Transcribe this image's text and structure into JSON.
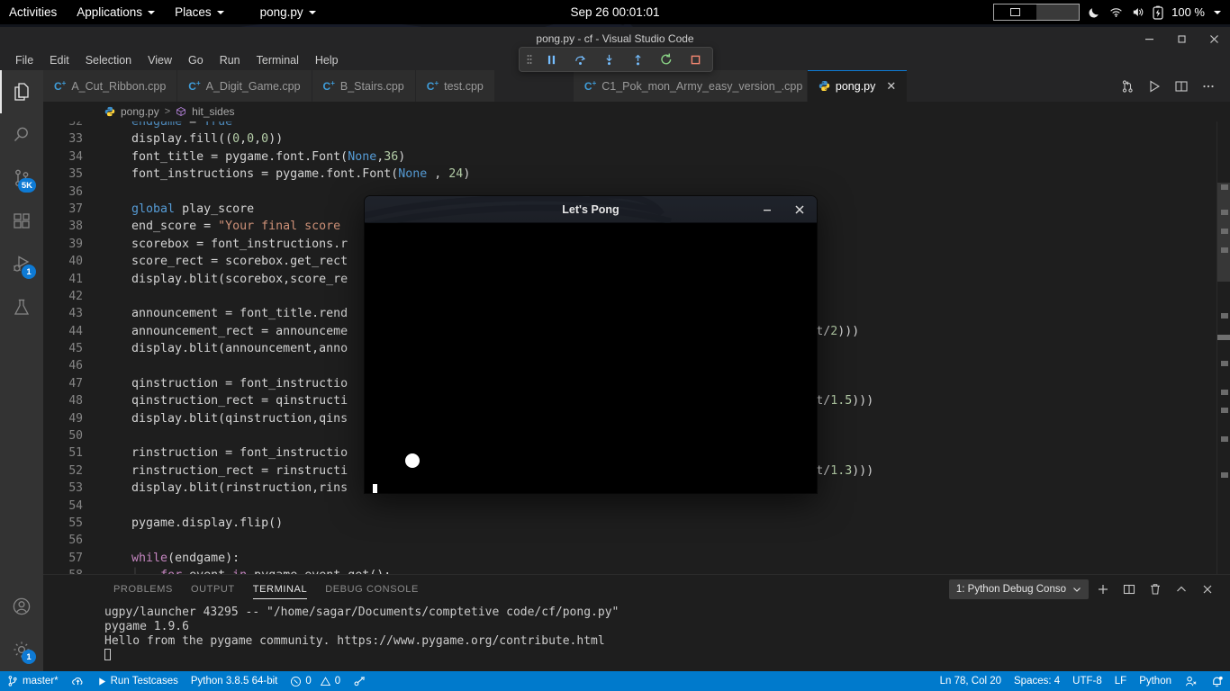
{
  "desktop": {
    "activities": "Activities",
    "applications": "Applications",
    "places": "Places",
    "app_menu": "pong.py",
    "clock": "Sep 26  00:01:01",
    "battery_percent": "100 %",
    "icons": [
      "night-light-icon",
      "wifi-icon",
      "volume-icon",
      "battery-icon"
    ]
  },
  "vscode": {
    "window_title": "pong.py - cf - Visual Studio Code",
    "menus": [
      "File",
      "Edit",
      "Selection",
      "View",
      "Go",
      "Run",
      "Terminal",
      "Help"
    ],
    "window_controls": [
      "minimize",
      "maximize",
      "close"
    ],
    "activity_bar": [
      {
        "name": "explorer",
        "icon": "files-icon",
        "badge": ""
      },
      {
        "name": "search",
        "icon": "search-icon",
        "badge": ""
      },
      {
        "name": "source-control",
        "icon": "source-control-icon",
        "badge": "5K"
      },
      {
        "name": "extensions",
        "icon": "extensions-icon",
        "badge": ""
      },
      {
        "name": "run-and-debug",
        "icon": "debug-icon",
        "badge": "1"
      },
      {
        "name": "testing",
        "icon": "beaker-icon",
        "badge": ""
      }
    ],
    "activity_bar_bottom": [
      {
        "name": "accounts",
        "icon": "account-icon",
        "badge": ""
      },
      {
        "name": "manage",
        "icon": "gear-icon",
        "badge": "1"
      }
    ],
    "tabs": [
      {
        "label": "A_Cut_Ribbon.cpp",
        "icon": "cpp-icon",
        "active": false,
        "dirty": true
      },
      {
        "label": "A_Digit_Game.cpp",
        "icon": "cpp-icon",
        "active": false,
        "dirty": false
      },
      {
        "label": "B_Stairs.cpp",
        "icon": "cpp-icon",
        "active": false,
        "dirty": false
      },
      {
        "label": "test.cpp",
        "icon": "cpp-icon",
        "active": false,
        "dirty": false
      },
      {
        "label": "C1_Pok_mon_Army_easy_version_.cpp",
        "icon": "cpp-icon",
        "active": false,
        "dirty": false
      },
      {
        "label": "pong.py",
        "icon": "python-icon",
        "active": true,
        "dirty": false
      }
    ],
    "tabbar_actions": [
      "split-editor-vertical-icon",
      "run-python-icon",
      "split-editor-icon",
      "more-actions-icon"
    ],
    "debug_toolbar": [
      "drag-handle-icon",
      "pause-icon",
      "step-over-icon",
      "step-into-icon",
      "step-out-icon",
      "restart-icon",
      "stop-icon"
    ],
    "breadcrumb": {
      "file": "pong.py",
      "separator": ">",
      "symbol": "hit_sides"
    }
  },
  "code": {
    "first_visible_line": 32,
    "lines": [
      {
        "n": "32",
        "text": "endgame = True",
        "clipped": true
      },
      {
        "n": "33",
        "text": "display.fill((0,0,0))"
      },
      {
        "n": "34",
        "text": "font_title = pygame.font.Font(None,36)"
      },
      {
        "n": "35",
        "text": "font_instructions = pygame.font.Font(None , 24)"
      },
      {
        "n": "36",
        "text": ""
      },
      {
        "n": "37",
        "text": "global play_score"
      },
      {
        "n": "38",
        "text": "end_score = \"Your final score"
      },
      {
        "n": "39",
        "text": "scorebox = font_instructions.r"
      },
      {
        "n": "40",
        "text": "score_rect = scorebox.get_rect"
      },
      {
        "n": "41",
        "text": "display.blit(scorebox,score_re"
      },
      {
        "n": "42",
        "text": ""
      },
      {
        "n": "43",
        "text": "announcement = font_title.rend"
      },
      {
        "n": "44",
        "text": "announcement_rect = announceme",
        "tail": "nt/2)))"
      },
      {
        "n": "45",
        "text": "display.blit(announcement,anno"
      },
      {
        "n": "46",
        "text": ""
      },
      {
        "n": "47",
        "text": "qinstruction = font_instructio"
      },
      {
        "n": "48",
        "text": "qinstruction_rect = qinstructi",
        "tail": "nt/1.5)))"
      },
      {
        "n": "49",
        "text": "display.blit(qinstruction,qins"
      },
      {
        "n": "50",
        "text": ""
      },
      {
        "n": "51",
        "text": "rinstruction = font_instructio"
      },
      {
        "n": "52",
        "text": "rinstruction_rect = rinstructi",
        "tail": "nt/1.3)))"
      },
      {
        "n": "53",
        "text": "display.blit(rinstruction,rins"
      },
      {
        "n": "54",
        "text": ""
      },
      {
        "n": "55",
        "text": "pygame.display.flip()"
      },
      {
        "n": "56",
        "text": ""
      },
      {
        "n": "57",
        "text": "while(endgame):"
      },
      {
        "n": "58",
        "text": "    for event in pygame.event.get():"
      }
    ]
  },
  "pygame_window": {
    "title": "Let's Pong",
    "controls": [
      "minimize",
      "close"
    ],
    "canvas_background": "#000000",
    "elements": [
      "ball",
      "left-paddle"
    ]
  },
  "panel": {
    "tabs": [
      "PROBLEMS",
      "OUTPUT",
      "TERMINAL",
      "DEBUG CONSOLE"
    ],
    "active_tab": "TERMINAL",
    "terminal_selector": "1: Python Debug Conso",
    "actions": [
      "new-terminal-icon",
      "split-terminal-icon",
      "kill-terminal-icon",
      "maximize-panel-icon",
      "close-panel-icon"
    ],
    "terminal_output": [
      "ugpy/launcher 43295 -- \"/home/sagar/Documents/comptetive code/cf/pong.py\"",
      "pygame 1.9.6",
      "Hello from the pygame community. https://www.pygame.org/contribute.html"
    ]
  },
  "statusbar": {
    "branch": "master*",
    "sync_icon": "sync-cloud-icon",
    "run_testcases": "Run Testcases",
    "python_version": "Python 3.8.5 64-bit",
    "errors": "0",
    "warnings": "0",
    "ports_icon": "remote-ports-icon",
    "cursor_position": "Ln 78, Col 20",
    "indentation": "Spaces: 4",
    "encoding": "UTF-8",
    "eol": "LF",
    "language": "Python",
    "feedback_icon": "feedback-icon",
    "bell_icon": "notification-bell-icon",
    "accent_color": "#007acc"
  }
}
